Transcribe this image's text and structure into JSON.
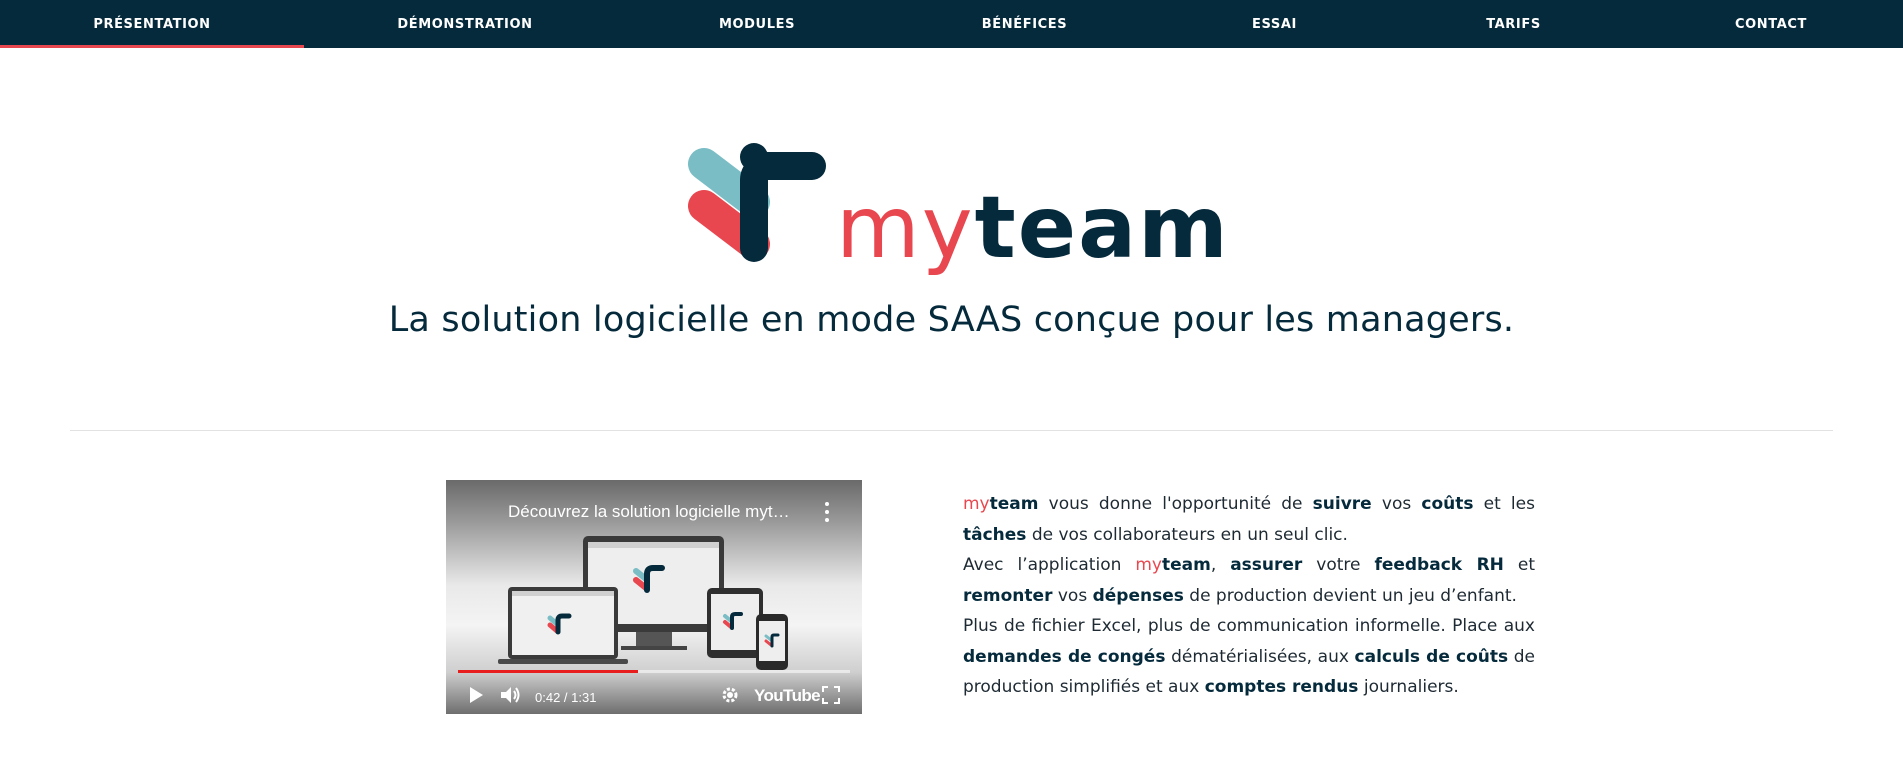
{
  "nav": {
    "items": [
      {
        "label": "PRÉSENTATION",
        "active": true
      },
      {
        "label": "DÉMONSTRATION",
        "active": false
      },
      {
        "label": "MODULES",
        "active": false
      },
      {
        "label": "BÉNÉFICES",
        "active": false
      },
      {
        "label": "ESSAI",
        "active": false
      },
      {
        "label": "TARIFS",
        "active": false
      },
      {
        "label": "CONTACT",
        "active": false
      }
    ]
  },
  "logo": {
    "my": "my",
    "team": "team"
  },
  "tagline": "La solution logicielle en mode SAAS conçue pour les managers.",
  "video": {
    "title": "Découvrez la solution logicielle myt…",
    "time": "0:42 / 1:31",
    "progress": 0.46,
    "brand": "YouTube"
  },
  "description": {
    "p1": {
      "brand_my": "my",
      "brand_team": "team",
      "t1": " vous donne l'opportunité de ",
      "b1": "suivre",
      "t2": " vos ",
      "b2": "coûts",
      "t3": " et les ",
      "b3": "tâches",
      "t4": " de vos collaborateurs en un seul clic."
    },
    "p2": {
      "t1": "Avec l’application ",
      "brand_my": "my",
      "brand_team": "team",
      "t2": ", ",
      "b1": "assurer",
      "t3": " votre ",
      "b2": "feedback RH",
      "t4": " et ",
      "b3": "remonter",
      "t5": " vos ",
      "b4": "dépenses",
      "t6": " de production devient un jeu d’enfant."
    },
    "p3": {
      "t1": "Plus de fichier Excel, plus de communication informelle. Place aux ",
      "b1": "demandes de congés",
      "t2": " dématérialisées, aux ",
      "b2": "calculs de coûts",
      "t3": " de production simplifiés et aux ",
      "b3": "comptes rendus",
      "t4": " journaliers."
    }
  },
  "colors": {
    "navy": "#052a3c",
    "red": "#e8474f",
    "teal": "#7bbdc5"
  }
}
